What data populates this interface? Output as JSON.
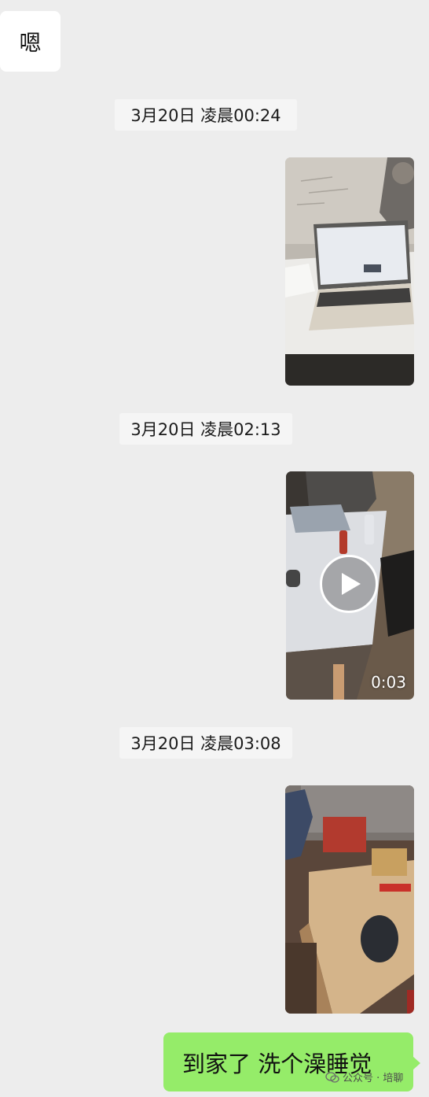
{
  "messages": {
    "incoming_text": "嗯",
    "timestamp_1": "3月20日 凌晨00:24",
    "timestamp_2": "3月20日 凌晨02:13",
    "timestamp_3": "3月20日 凌晨03:08",
    "video_duration": "0:03",
    "outgoing_text": "到家了 洗个澡睡觉"
  },
  "watermark": {
    "text": "公众号 · 培聊"
  },
  "colors": {
    "background": "#ededed",
    "incoming_bubble": "#ffffff",
    "outgoing_bubble": "#95ec69",
    "timestamp_bg": "#f5f5f5"
  },
  "icons": {
    "video_play": "play-icon",
    "watermark": "wechat-official-account-icon"
  }
}
